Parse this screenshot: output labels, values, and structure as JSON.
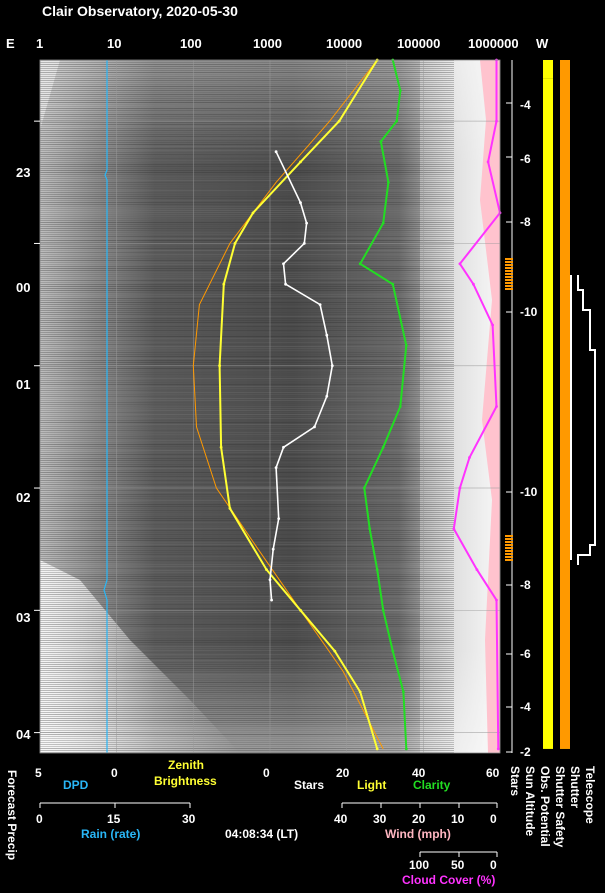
{
  "title": "Clair Observatory, 2020-05-30",
  "top_axis": {
    "left_end": "E",
    "right_end": "W",
    "ticks": [
      "1",
      "10",
      "100",
      "1000",
      "10000",
      "100000",
      "1000000"
    ]
  },
  "hour_labels": [
    "23",
    "00",
    "01",
    "02",
    "03",
    "04"
  ],
  "sun_altitude_labels": [
    "-4",
    "-6",
    "-8",
    "-10",
    "-10",
    "-8",
    "-6",
    "-4",
    "-2"
  ],
  "right_column_labels": [
    "Stars",
    "Sun Altitude",
    "Obs. Potential",
    "Shutter Safety",
    "Shutter",
    "Telescope"
  ],
  "forecast_precip_label": "Forecast Precip",
  "timestamp": "04:08:34 (LT)",
  "bottom_axes": {
    "dpd": {
      "label": "DPD",
      "ticks": [
        "5",
        "0"
      ],
      "color": "#29b6f6"
    },
    "zenith": {
      "label_line1": "Zenith",
      "label_line2": "Brightness",
      "color": "#ffff33"
    },
    "stars_light_clarity": {
      "ticks": [
        "0",
        "20",
        "40",
        "60"
      ],
      "stars": "Stars",
      "light": "Light",
      "clarity": "Clarity"
    },
    "rain": {
      "label": "Rain (rate)",
      "ticks": [
        "0",
        "15",
        "30"
      ],
      "color": "#29b6f6"
    },
    "wind": {
      "label": "Wind (mph)",
      "ticks": [
        "40",
        "30",
        "20",
        "10",
        "0"
      ],
      "color": "#ffb6c1"
    },
    "cloud": {
      "label": "Cloud Cover (%)",
      "ticks": [
        "100",
        "50",
        "0"
      ],
      "color": "#ff33ff"
    }
  },
  "chart_data": {
    "type": "line",
    "title": "Clair Observatory, 2020-05-30",
    "x_scale": "log",
    "x_range": [
      1,
      1000000
    ],
    "y_range_local_time": [
      "22:30",
      "04:10"
    ],
    "series": [
      {
        "name": "Zenith Brightness",
        "color": "#ffff33",
        "points": [
          [
            "22:30",
            25000
          ],
          [
            "23:00",
            8000
          ],
          [
            "23:20",
            2500
          ],
          [
            "23:45",
            600
          ],
          [
            "00:00",
            350
          ],
          [
            "00:20",
            250
          ],
          [
            "01:00",
            220
          ],
          [
            "01:40",
            230
          ],
          [
            "02:10",
            300
          ],
          [
            "02:40",
            900
          ],
          [
            "03:00",
            2500
          ],
          [
            "03:20",
            7000
          ],
          [
            "03:40",
            15000
          ],
          [
            "04:08",
            25000
          ]
        ]
      },
      {
        "name": "Stars",
        "color": "#ffffff",
        "points": [
          [
            "23:15",
            1200
          ],
          [
            "23:40",
            2500
          ],
          [
            "23:50",
            3000
          ],
          [
            "00:00",
            2800
          ],
          [
            "00:10",
            1500
          ],
          [
            "00:20",
            1600
          ],
          [
            "00:30",
            4500
          ],
          [
            "00:45",
            5500
          ],
          [
            "01:00",
            6500
          ],
          [
            "01:15",
            5500
          ],
          [
            "01:30",
            3800
          ],
          [
            "01:40",
            1500
          ],
          [
            "01:50",
            1200
          ],
          [
            "02:15",
            1300
          ],
          [
            "02:30",
            1100
          ],
          [
            "02:45",
            1000
          ],
          [
            "02:55",
            1050
          ]
        ]
      },
      {
        "name": "Clarity",
        "color": "#22dd22",
        "points": [
          [
            "22:30",
            40000
          ],
          [
            "22:45",
            50000
          ],
          [
            "23:00",
            45000
          ],
          [
            "23:10",
            28000
          ],
          [
            "23:30",
            35000
          ],
          [
            "23:50",
            30000
          ],
          [
            "00:10",
            15000
          ],
          [
            "00:20",
            40000
          ],
          [
            "00:50",
            60000
          ],
          [
            "01:20",
            50000
          ],
          [
            "01:40",
            30000
          ],
          [
            "02:00",
            17000
          ],
          [
            "02:20",
            20000
          ],
          [
            "02:40",
            25000
          ],
          [
            "03:00",
            30000
          ],
          [
            "03:20",
            40000
          ],
          [
            "03:40",
            55000
          ],
          [
            "04:08",
            60000
          ]
        ]
      },
      {
        "name": "Cloud Cover",
        "color": "#ff33ff",
        "points": [
          [
            "22:30",
            900000
          ],
          [
            "23:00",
            900000
          ],
          [
            "23:20",
            700000
          ],
          [
            "23:45",
            1000000
          ],
          [
            "00:10",
            300000
          ],
          [
            "00:20",
            450000
          ],
          [
            "00:40",
            800000
          ],
          [
            "01:20",
            900000
          ],
          [
            "01:45",
            400000
          ],
          [
            "02:00",
            300000
          ],
          [
            "02:20",
            250000
          ],
          [
            "02:40",
            500000
          ],
          [
            "02:55",
            900000
          ],
          [
            "04:08",
            950000
          ]
        ]
      }
    ],
    "bars": [
      {
        "name": "Sun Altitude",
        "segments": [
          [
            "22:30",
            "22:39",
            "yellow"
          ],
          [
            "22:39",
            "04:08",
            "yellow"
          ]
        ]
      },
      {
        "name": "Obs. Potential",
        "segments": [
          [
            "22:30",
            "22:39",
            "orange"
          ],
          [
            "22:39",
            "23:40",
            "green"
          ],
          [
            "23:40",
            "00:15",
            "orange"
          ],
          [
            "00:15",
            "00:25",
            "red"
          ],
          [
            "00:25",
            "01:30",
            "green"
          ],
          [
            "01:30",
            "02:20",
            "red"
          ],
          [
            "02:20",
            "04:08",
            "green"
          ]
        ]
      },
      {
        "name": "Shutter Safety",
        "segments": [
          [
            "22:30",
            "04:08",
            "orange"
          ]
        ]
      }
    ]
  }
}
